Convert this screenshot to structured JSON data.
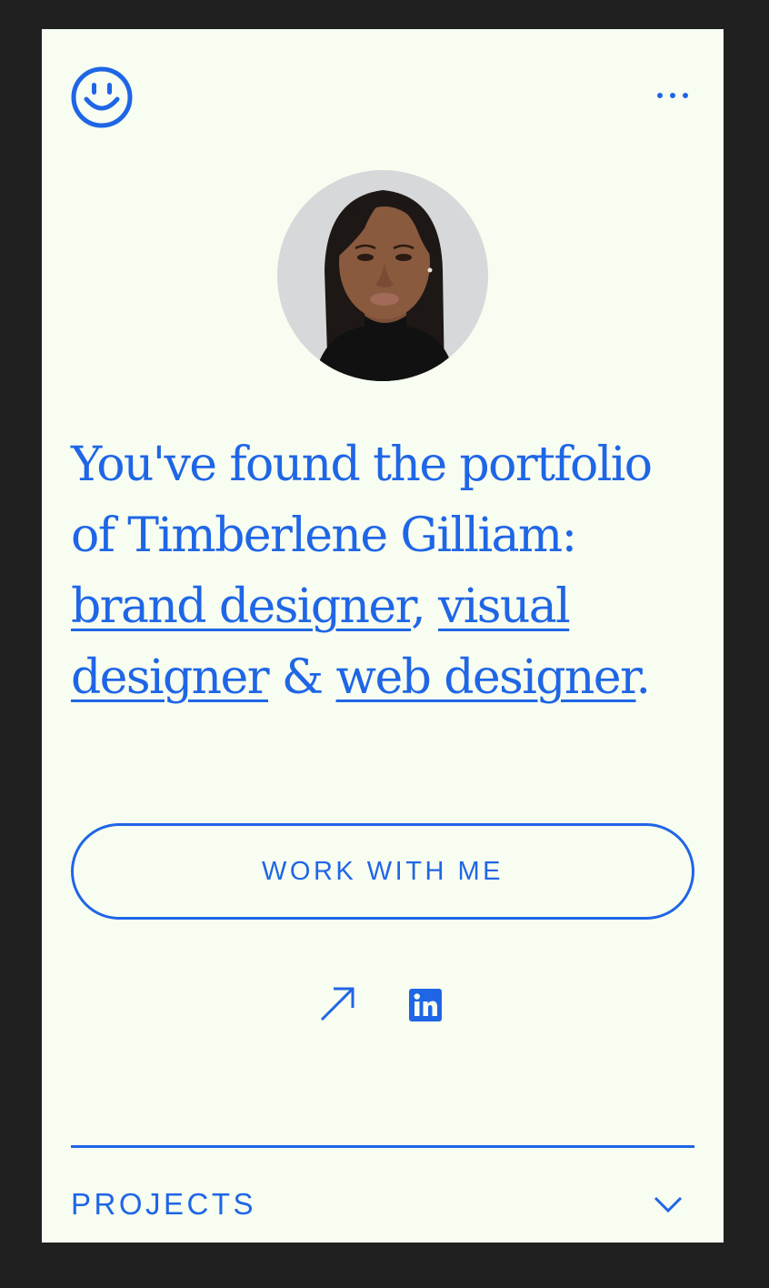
{
  "theme": {
    "accent": "#1f66e6",
    "background": "#f8fdf1",
    "outer": "#202020"
  },
  "header": {
    "logo_icon": "smiley-face-icon",
    "menu_icon": "more-dots-icon"
  },
  "profile": {
    "avatar": "profile-photo"
  },
  "headline": {
    "intro": "You've found the portfolio of Timberlene Gilliam: ",
    "link1": "brand designer",
    "sep1": ", ",
    "link2": "visual designer",
    "sep2": " & ",
    "link3": "web designer",
    "end": "."
  },
  "cta": {
    "label": "WORK WITH ME"
  },
  "social": {
    "external_link_icon": "arrow-up-right-icon",
    "linkedin_icon": "linkedin-icon"
  },
  "sections": {
    "projects": {
      "label": "PROJECTS",
      "icon": "chevron-down-icon"
    }
  }
}
